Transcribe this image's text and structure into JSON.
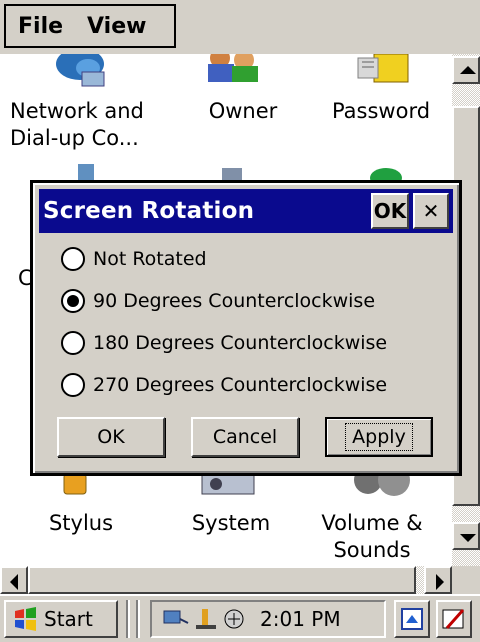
{
  "menubar": {
    "file": "File",
    "view": "View"
  },
  "icons": [
    {
      "name": "network-icon",
      "label": "Network and Dial-up Co..."
    },
    {
      "name": "owner-icon",
      "label": "Owner"
    },
    {
      "name": "password-icon",
      "label": "Password"
    },
    {
      "name": "stylus-icon",
      "label": "Stylus"
    },
    {
      "name": "system-icon",
      "label": "System"
    },
    {
      "name": "volume-icon",
      "label": "Volume & Sounds"
    }
  ],
  "partial_letter": "C",
  "dialog": {
    "title": "Screen Rotation",
    "ok_title": "OK",
    "close_glyph": "✕",
    "options": [
      {
        "label": "Not Rotated",
        "selected": false
      },
      {
        "label": "90 Degrees Counterclockwise",
        "selected": true
      },
      {
        "label": "180 Degrees Counterclockwise",
        "selected": false
      },
      {
        "label": "270 Degrees Counterclockwise",
        "selected": false
      }
    ],
    "buttons": {
      "ok": "OK",
      "cancel": "Cancel",
      "apply": "Apply"
    }
  },
  "taskbar": {
    "start": "Start",
    "time": "2:01 PM"
  },
  "colors": {
    "title_bar": "#0a0a8e",
    "face": "#d4d0c8"
  }
}
